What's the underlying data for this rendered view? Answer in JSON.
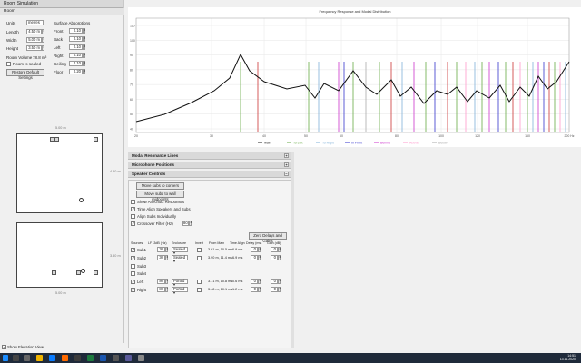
{
  "window": {
    "title": "Room Simulation"
  },
  "room": {
    "section_title": "Room",
    "units_label": "Units",
    "units_value": "metres",
    "length_label": "Length",
    "length_value": "4.50 m",
    "width_label": "Width",
    "width_value": "5.00 m",
    "height_label": "Height",
    "height_value": "3.50 m",
    "volume_label": "Room Volume",
    "volume_value": "78.8 m³",
    "sealed_label": "Room is sealed",
    "restore_label": "Restore Default Settings",
    "surface_title": "Surface Absorptions",
    "surfaces": [
      {
        "label": "Front",
        "value": "0.10"
      },
      {
        "label": "Back",
        "value": "0.10"
      },
      {
        "label": "Left",
        "value": "0.10"
      },
      {
        "label": "Right",
        "value": "0.10"
      },
      {
        "label": "Ceiling",
        "value": "0.10"
      },
      {
        "label": "Floor",
        "value": "0.20"
      }
    ],
    "dims": {
      "plan_width": "5.00 m",
      "plan_depth": "4.50 m",
      "elev_height": "3.50 m",
      "elev_width": "5.00 m"
    },
    "show_elevation_label": "Show Elevation View"
  },
  "graph": {
    "title": "Frequency Response and Modal Distribution",
    "legend": [
      {
        "label": "Main",
        "color": "#222222"
      },
      {
        "label": "To Left",
        "color": "#66aa44"
      },
      {
        "label": "To Right",
        "color": "#7fb0d8"
      },
      {
        "label": "In Front",
        "color": "#3333cc"
      },
      {
        "label": "Behind",
        "color": "#cc33cc"
      },
      {
        "label": "Above",
        "color": "#ff99cc"
      },
      {
        "label": "Below",
        "color": "#aaaaaa"
      }
    ],
    "y_ticks": [
      "110",
      "100",
      "90",
      "80",
      "70",
      "60",
      "50",
      "40"
    ],
    "x_ticks": [
      "20",
      "30",
      "40",
      "50",
      "60",
      "80",
      "100",
      "120",
      "160",
      "200 Hz"
    ]
  },
  "panels": {
    "modal": "Modal Resonance Lines",
    "mic": "Microphone Positions",
    "speaker": "Speaker Controls"
  },
  "speaker_controls": {
    "move_corners": "Move subs to corners",
    "move_midpoints": "Move subs to wall midpoints",
    "anechoic": "Show Anechoic Responses",
    "time_align": "Time Align Speakers and Subs",
    "align_individually": "Align Subs Individually",
    "crossover_label": "Crossover Filter (Hz)",
    "crossover_value": "80",
    "zero_delays": "Zero Delays and Gains",
    "headers": [
      "Sources",
      "LF -3dB (Hz)",
      "Enclosure",
      "Invert",
      "From Main",
      "Time Align",
      "Delay (ms)",
      "Gain (dB)"
    ],
    "sources": [
      {
        "name": "Sub1",
        "lf": "30",
        "enclosure": "Sealed",
        "from_main": "3.61 m, 10.5 ms",
        "time_align": "6.9 ms",
        "delay": "0",
        "gain": "0"
      },
      {
        "name": "Sub2",
        "lf": "30",
        "enclosure": "Sealed",
        "from_main": "3.90 m, 11.4 ms",
        "time_align": "6.9 ms",
        "delay": "0",
        "gain": "0"
      },
      {
        "name": "Sub3"
      },
      {
        "name": "Sub4"
      },
      {
        "name": "Left",
        "lf": "80",
        "enclosure": "Ported",
        "from_main": "3.71 m, 10.8 ms",
        "time_align": "0.6 ms",
        "delay": "0",
        "gain": "0"
      },
      {
        "name": "Right",
        "lf": "80",
        "enclosure": "Ported",
        "from_main": "3.48 m, 10.1 ms",
        "time_align": "1.2 ms",
        "delay": "0",
        "gain": "0"
      }
    ]
  },
  "taskbar": {
    "time": "14:51",
    "date": "13.11.2020"
  }
}
